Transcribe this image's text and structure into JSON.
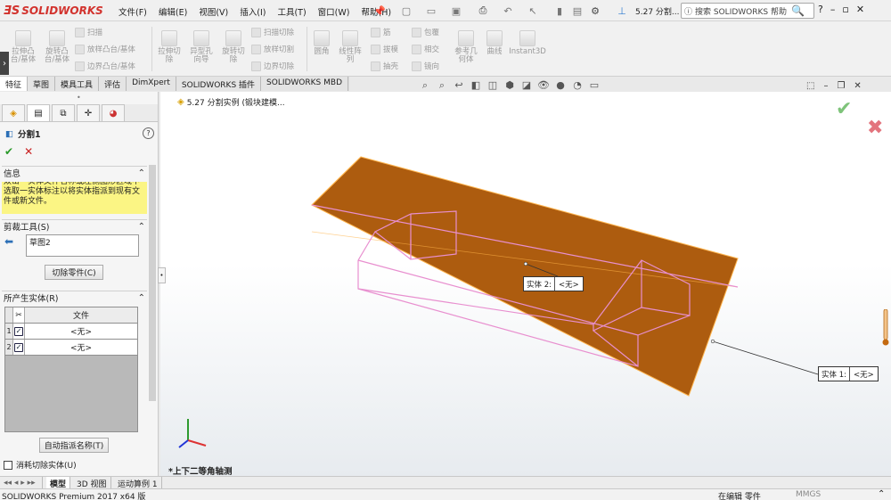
{
  "app": {
    "brand": "SOLIDWORKS",
    "brand_color": "#d2322d"
  },
  "menu": [
    "文件(F)",
    "编辑(E)",
    "视图(V)",
    "插入(I)",
    "工具(T)",
    "窗口(W)",
    "帮助(H)"
  ],
  "doc_title": "5.27 分割...",
  "search": {
    "placeholder": "搜索 SOLIDWORKS 帮助"
  },
  "commands": {
    "extrude_boss": "拉伸凸\n台/基体",
    "revolve_boss": "旋转凸\n台/基体",
    "sweep": "扫描",
    "loft": "放样凸台/基体",
    "boundary": "边界凸台/基体",
    "extrude_cut": "拉伸切\n除",
    "hole_wizard": "异型孔\n向导",
    "revolve_cut": "旋转切\n除",
    "swept_cut": "扫描切除",
    "lofted_cut": "放样切割",
    "boundary_cut": "边界切除",
    "fillet": "圆角",
    "linear_pattern": "线性阵\n列",
    "rib": "筋",
    "draft": "拔模",
    "shell": "抽壳",
    "wrap": "包覆",
    "intersect": "相交",
    "mirror": "镜向",
    "ref_geometry": "参考几\n何体",
    "curves": "曲线",
    "instant3d": "Instant3D"
  },
  "tabs": [
    "特征",
    "草图",
    "模具工具",
    "评估",
    "DimXpert",
    "SOLIDWORKS 插件",
    "SOLIDWORKS MBD"
  ],
  "active_tab": "特征",
  "feature": {
    "name": "分割1"
  },
  "info": {
    "title": "信息",
    "text": "双击一实体文件名称或左侧图形区域中选取一实体标注以将实体指派到现有文件或新文件。"
  },
  "trim_tools": {
    "title": "剪裁工具(S)",
    "sketch": "草图2",
    "cut_button": "切除零件(C)"
  },
  "resulting_bodies": {
    "title": "所产生实体(R)",
    "column": "文件",
    "rows": [
      {
        "num": "1",
        "checked": true,
        "file": "<无>"
      },
      {
        "num": "2",
        "checked": true,
        "file": "<无>"
      }
    ],
    "auto_assign_button": "自动指派名称(T)",
    "consume_label": "消耗切除实体(U)"
  },
  "breadcrumb": "5.27 分割实例 (锻块建模...",
  "callouts": [
    {
      "label": "实体 2:",
      "value": "<无>"
    },
    {
      "label": "实体 1:",
      "value": "<无>"
    }
  ],
  "view_name": "*上下二等角轴测",
  "bottom_tabs": [
    "模型",
    "3D 视图",
    "运动算例 1"
  ],
  "status": {
    "product": "SOLIDWORKS Premium 2017 x64 版",
    "mode": "在编辑 零件",
    "units": "MMGS"
  },
  "colors": {
    "solid_fill": "#a85200",
    "split_outline": "#e88fcf",
    "confirm": "#7ec37a",
    "cancel": "#e3747d",
    "info_bg": "#fbf584"
  }
}
